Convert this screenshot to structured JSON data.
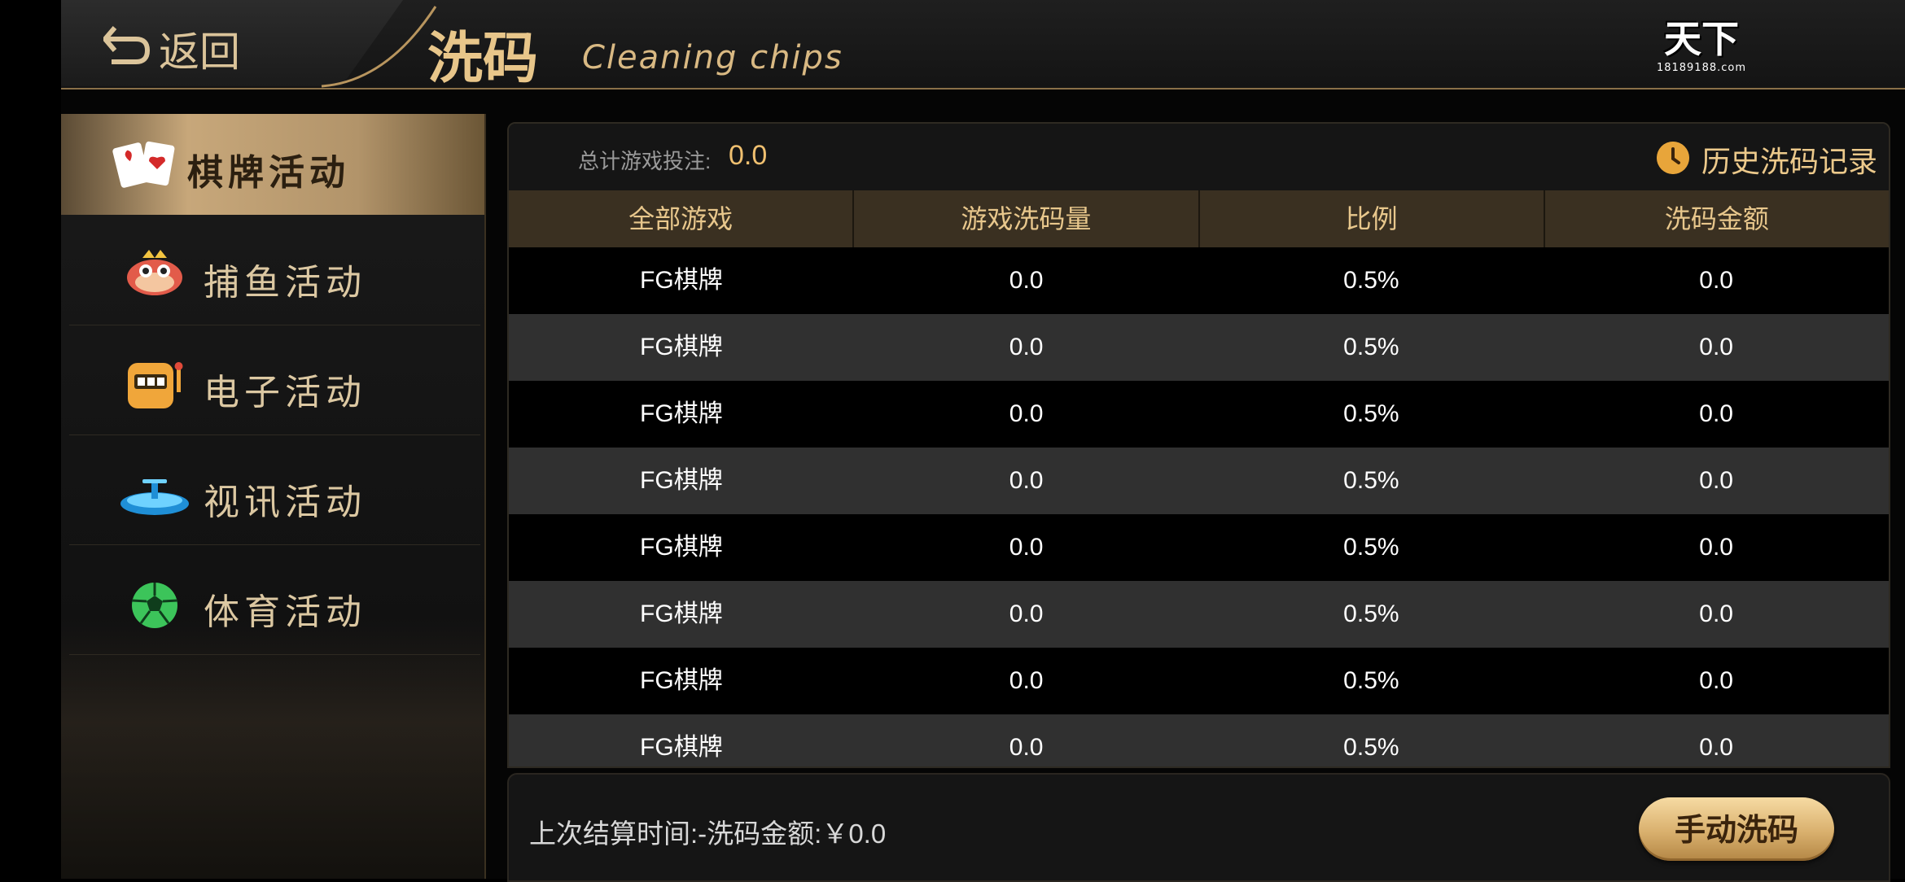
{
  "header": {
    "back_label": "返回",
    "title": "洗码",
    "subtitle": "Cleaning chips",
    "logo_text": "天下",
    "logo_sub": "18189188.com"
  },
  "sidebar": {
    "items": [
      {
        "label": "棋牌活动",
        "icon": "playing-cards-icon",
        "active": true
      },
      {
        "label": "捕鱼活动",
        "icon": "fish-icon",
        "active": false
      },
      {
        "label": "电子活动",
        "icon": "slot-machine-icon",
        "active": false
      },
      {
        "label": "视讯活动",
        "icon": "roulette-icon",
        "active": false
      },
      {
        "label": "体育活动",
        "icon": "soccer-ball-icon",
        "active": false
      }
    ]
  },
  "summary": {
    "label": "总计游戏投注:",
    "value": "0.0",
    "history_label": "历史洗码记录"
  },
  "table": {
    "headers": [
      "全部游戏",
      "游戏洗码量",
      "比例",
      "洗码金额"
    ],
    "rows": [
      [
        "FG棋牌",
        "0.0",
        "0.5%",
        "0.0"
      ],
      [
        "FG棋牌",
        "0.0",
        "0.5%",
        "0.0"
      ],
      [
        "FG棋牌",
        "0.0",
        "0.5%",
        "0.0"
      ],
      [
        "FG棋牌",
        "0.0",
        "0.5%",
        "0.0"
      ],
      [
        "FG棋牌",
        "0.0",
        "0.5%",
        "0.0"
      ],
      [
        "FG棋牌",
        "0.0",
        "0.5%",
        "0.0"
      ],
      [
        "FG棋牌",
        "0.0",
        "0.5%",
        "0.0"
      ],
      [
        "FG棋牌",
        "0.0",
        "0.5%",
        "0.0"
      ]
    ]
  },
  "footer": {
    "text": "上次结算时间:-洗码金额:￥0.0",
    "button_label": "手动洗码"
  },
  "colors": {
    "accent_gold": "#e8c68a",
    "header_row": "#3a3021",
    "button_gold": "#d9b06d"
  }
}
